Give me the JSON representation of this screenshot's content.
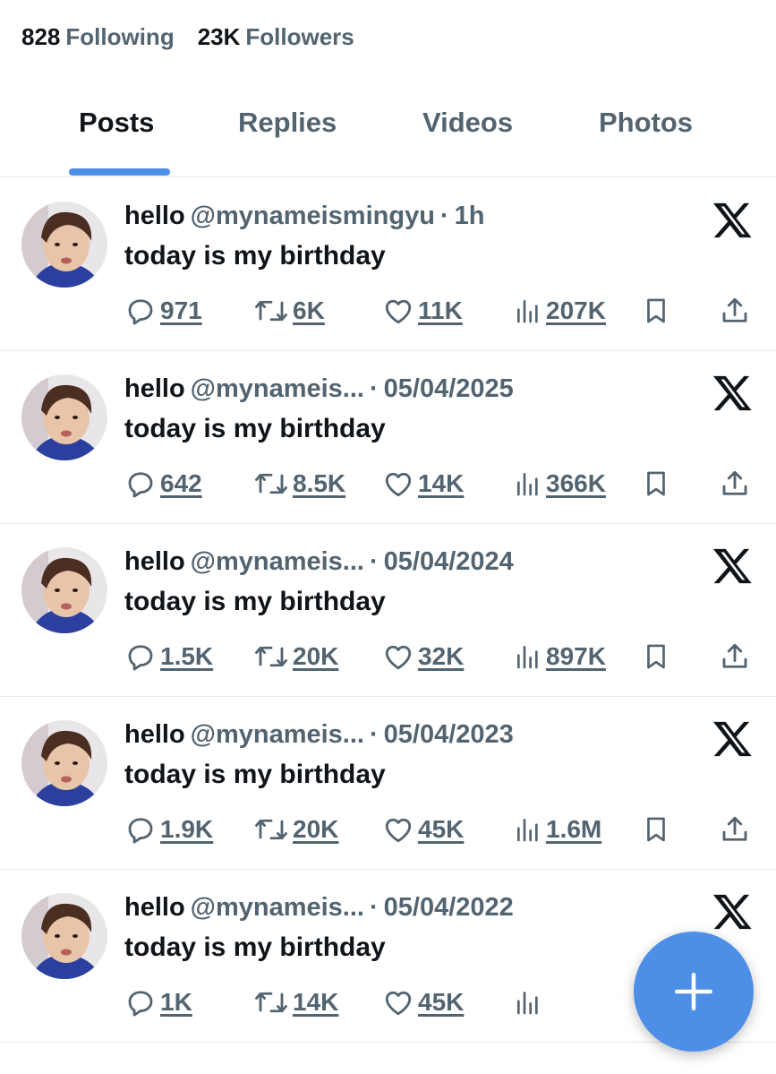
{
  "profile_stats": {
    "following_count": "828",
    "following_label": "Following",
    "followers_count": "23K",
    "followers_label": "Followers"
  },
  "tabs": [
    {
      "label": "Posts",
      "active": true
    },
    {
      "label": "Replies",
      "active": false
    },
    {
      "label": "Videos",
      "active": false
    },
    {
      "label": "Photos",
      "active": false
    }
  ],
  "posts": [
    {
      "name": "hello",
      "handle": "@mynameismingyu",
      "dot": "·",
      "time": "1h",
      "text": "today is my birthday",
      "replies": "971",
      "reposts": "6K",
      "likes": "11K",
      "views": "207K"
    },
    {
      "name": "hello",
      "handle": "@mynameis...",
      "dot": "·",
      "time": "05/04/2025",
      "text": "today is my birthday",
      "replies": "642",
      "reposts": "8.5K",
      "likes": "14K",
      "views": "366K"
    },
    {
      "name": "hello",
      "handle": "@mynameis...",
      "dot": "·",
      "time": "05/04/2024",
      "text": "today is my birthday",
      "replies": "1.5K",
      "reposts": "20K",
      "likes": "32K",
      "views": "897K"
    },
    {
      "name": "hello",
      "handle": "@mynameis...",
      "dot": "·",
      "time": "05/04/2023",
      "text": "today is my birthday",
      "replies": "1.9K",
      "reposts": "20K",
      "likes": "45K",
      "views": "1.6M"
    },
    {
      "name": "hello",
      "handle": "@mynameis...",
      "dot": "·",
      "time": "05/04/2022",
      "text": "today is my birthday",
      "replies": "1K",
      "reposts": "14K",
      "likes": "45K",
      "views": ""
    }
  ],
  "icons": {
    "reply": "speech-bubble-icon",
    "repost": "repost-arrows-icon",
    "like": "heart-icon",
    "views": "bar-chart-icon",
    "bookmark": "bookmark-icon",
    "share": "share-upload-icon",
    "brand": "x-logo-icon",
    "compose": "plus-icon"
  },
  "colors": {
    "accent": "#4d8ee6",
    "text_primary": "#0f1419",
    "text_secondary": "#536471",
    "divider": "#e6e9eb"
  }
}
